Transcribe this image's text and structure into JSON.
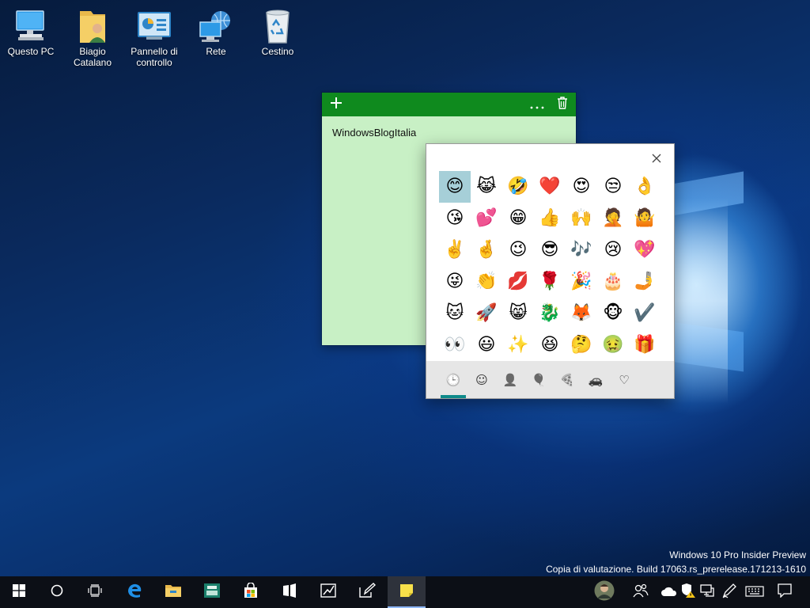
{
  "desktop": {
    "icons": [
      {
        "label": "Questo PC",
        "icon": "this-pc-icon"
      },
      {
        "label": "Biagio Catalano",
        "icon": "user-folder-icon"
      },
      {
        "label": "Pannello di controllo",
        "icon": "control-panel-icon"
      },
      {
        "label": "Rete",
        "icon": "network-icon"
      },
      {
        "label": "Cestino",
        "icon": "recycle-bin-icon"
      }
    ]
  },
  "sticky_note": {
    "text": "WindowsBlogItalia",
    "add_icon": "plus-icon",
    "menu_icon": "more-icon",
    "delete_icon": "trash-icon",
    "colors": {
      "header": "#0f8a1e",
      "body": "#c8f0c5"
    }
  },
  "emoji_panel": {
    "close_icon": "close-icon",
    "selected_index": 0,
    "emojis": [
      "😊",
      "😹",
      "🤣",
      "❤️",
      "😍",
      "😒",
      "👌",
      "😘",
      "💕",
      "😁",
      "👍",
      "🙌",
      "🤦",
      "🤷",
      "✌️",
      "🤞",
      "😉",
      "😎",
      "🎶",
      "😢",
      "💖",
      "😜",
      "👏",
      "💋",
      "🌹",
      "🎉",
      "🎂",
      "🤳",
      "🐱",
      "🚀",
      "😸",
      "🐉",
      "🦊",
      "🐵",
      "✔️",
      "👀",
      "😃",
      "✨",
      "😆",
      "🤔",
      "🤢",
      "🎁"
    ],
    "tabs": [
      {
        "icon": "recent-clock-icon",
        "glyph": "🕒",
        "active": true
      },
      {
        "icon": "smiley-icon",
        "glyph": "☺",
        "active": false
      },
      {
        "icon": "people-icon",
        "glyph": "👤",
        "active": false
      },
      {
        "icon": "balloon-icon",
        "glyph": "🎈",
        "active": false
      },
      {
        "icon": "pizza-icon",
        "glyph": "🍕",
        "active": false
      },
      {
        "icon": "car-icon",
        "glyph": "🚗",
        "active": false
      },
      {
        "icon": "heart-icon",
        "glyph": "♡",
        "active": false
      }
    ],
    "accent": "#0e8a8a"
  },
  "watermark": {
    "line1": "Windows 10 Pro Insider Preview",
    "line2": "Copia di valutazione. Build 17063.rs_prerelease.171213-1610"
  },
  "taskbar": {
    "apps": [
      {
        "name": "start-button",
        "icon": "windows-logo-icon"
      },
      {
        "name": "cortana-button",
        "icon": "cortana-circle-icon"
      },
      {
        "name": "task-view-button",
        "icon": "task-view-icon"
      },
      {
        "name": "edge-button",
        "icon": "edge-icon"
      },
      {
        "name": "file-explorer-button",
        "icon": "folder-icon"
      },
      {
        "name": "app-button",
        "icon": "printer-app-icon"
      },
      {
        "name": "store-button",
        "icon": "store-icon"
      },
      {
        "name": "windows-app-button",
        "icon": "window-app-icon"
      },
      {
        "name": "sketch-app-button",
        "icon": "sketch-icon"
      },
      {
        "name": "notes-app-button",
        "icon": "pen-icon"
      },
      {
        "name": "sticky-notes-button",
        "icon": "sticky-notes-icon",
        "active": true
      }
    ],
    "tray": [
      {
        "name": "avatar",
        "icon": "user-avatar-icon"
      },
      {
        "name": "people-button",
        "icon": "people-icon"
      },
      {
        "name": "onedrive-button",
        "icon": "cloud-icon"
      },
      {
        "name": "defender-button",
        "icon": "shield-warning-icon"
      },
      {
        "name": "network-button",
        "icon": "ethernet-icon"
      },
      {
        "name": "pen-workspace-button",
        "icon": "pen-workspace-icon"
      },
      {
        "name": "touch-keyboard-button",
        "icon": "keyboard-icon"
      },
      {
        "name": "action-center-button",
        "icon": "notification-icon"
      }
    ]
  }
}
